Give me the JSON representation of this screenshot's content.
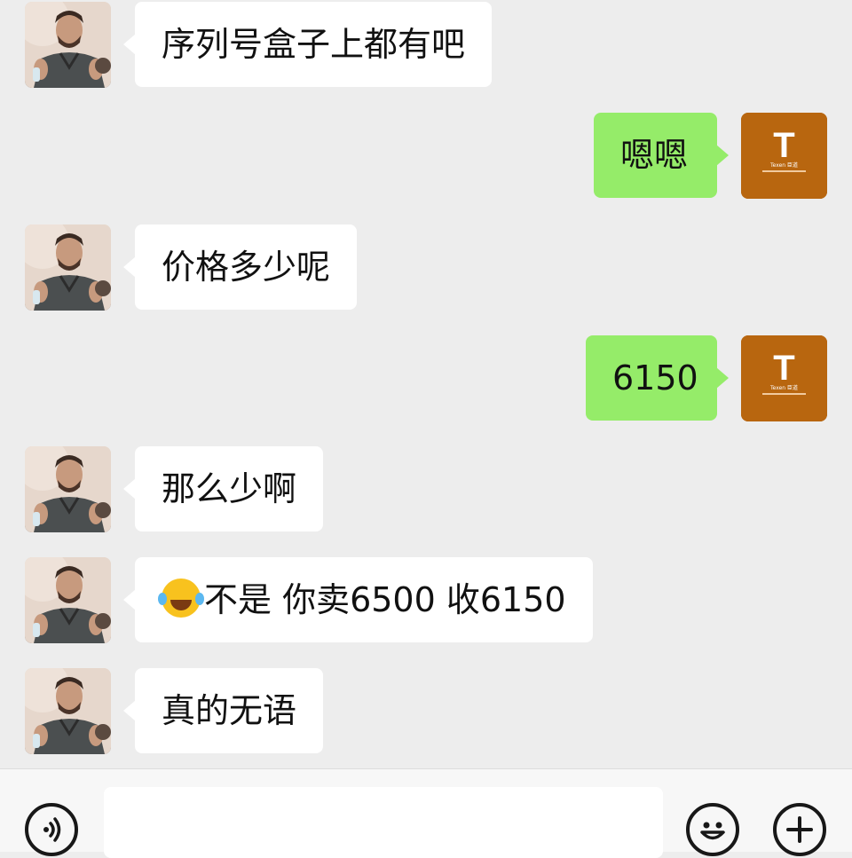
{
  "messages": [
    {
      "side": "in",
      "text": "序列号盒子上都有吧"
    },
    {
      "side": "out",
      "text": "嗯嗯"
    },
    {
      "side": "in",
      "text": "价格多少呢"
    },
    {
      "side": "out",
      "text": "6150"
    },
    {
      "side": "in",
      "text": "那么少啊"
    },
    {
      "side": "in",
      "emoji": "laughing-tears-emoji",
      "text": "不是 你卖6500 收6150"
    },
    {
      "side": "in",
      "text": "真的无语"
    }
  ],
  "brand_avatar": {
    "letter": "T",
    "caption": "Texen 臣道"
  },
  "input_bar": {
    "icons": [
      "voice-icon",
      "emoji-face-icon",
      "plus-icon"
    ]
  },
  "colors": {
    "background": "#ededed",
    "incoming_bubble": "#ffffff",
    "outgoing_bubble": "#95ec69",
    "brand_avatar": "#b8660f"
  }
}
